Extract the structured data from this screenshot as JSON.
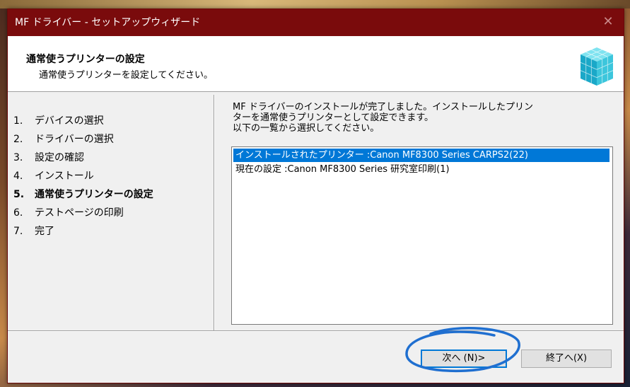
{
  "window": {
    "title": "MF ドライバー - セットアップウィザード",
    "close_glyph": "✕"
  },
  "header": {
    "title": "通常使うプリンターの設定",
    "subtitle": "通常使うプリンターを設定してください。",
    "logo_icon": "cube-stack-icon"
  },
  "steps": [
    {
      "num": "1.",
      "label": "デバイスの選択"
    },
    {
      "num": "2.",
      "label": "ドライバーの選択"
    },
    {
      "num": "3.",
      "label": "設定の確認"
    },
    {
      "num": "4.",
      "label": "インストール"
    },
    {
      "num": "5.",
      "label": "通常使うプリンターの設定",
      "active": true
    },
    {
      "num": "6.",
      "label": "テストページの印刷"
    },
    {
      "num": "7.",
      "label": "完了"
    }
  ],
  "description": {
    "line1": "MF ドライバーのインストールが完了しました。インストールしたプリン",
    "line2": "ターを通常使うプリンターとして設定できます。",
    "line3": "以下の一覧から選択してください。"
  },
  "printer_list": [
    {
      "label": "インストールされたプリンター :Canon MF8300 Series CARPS2(22)",
      "selected": true
    },
    {
      "label": "現在の設定 :Canon MF8300 Series 研究室印刷(1)",
      "selected": false
    }
  ],
  "buttons": {
    "next": "次へ (N)>",
    "finish": "終了へ(X)"
  },
  "colors": {
    "titlebar": "#7a0b0c",
    "selection": "#0078d7",
    "annotation": "#1f6fd0"
  }
}
